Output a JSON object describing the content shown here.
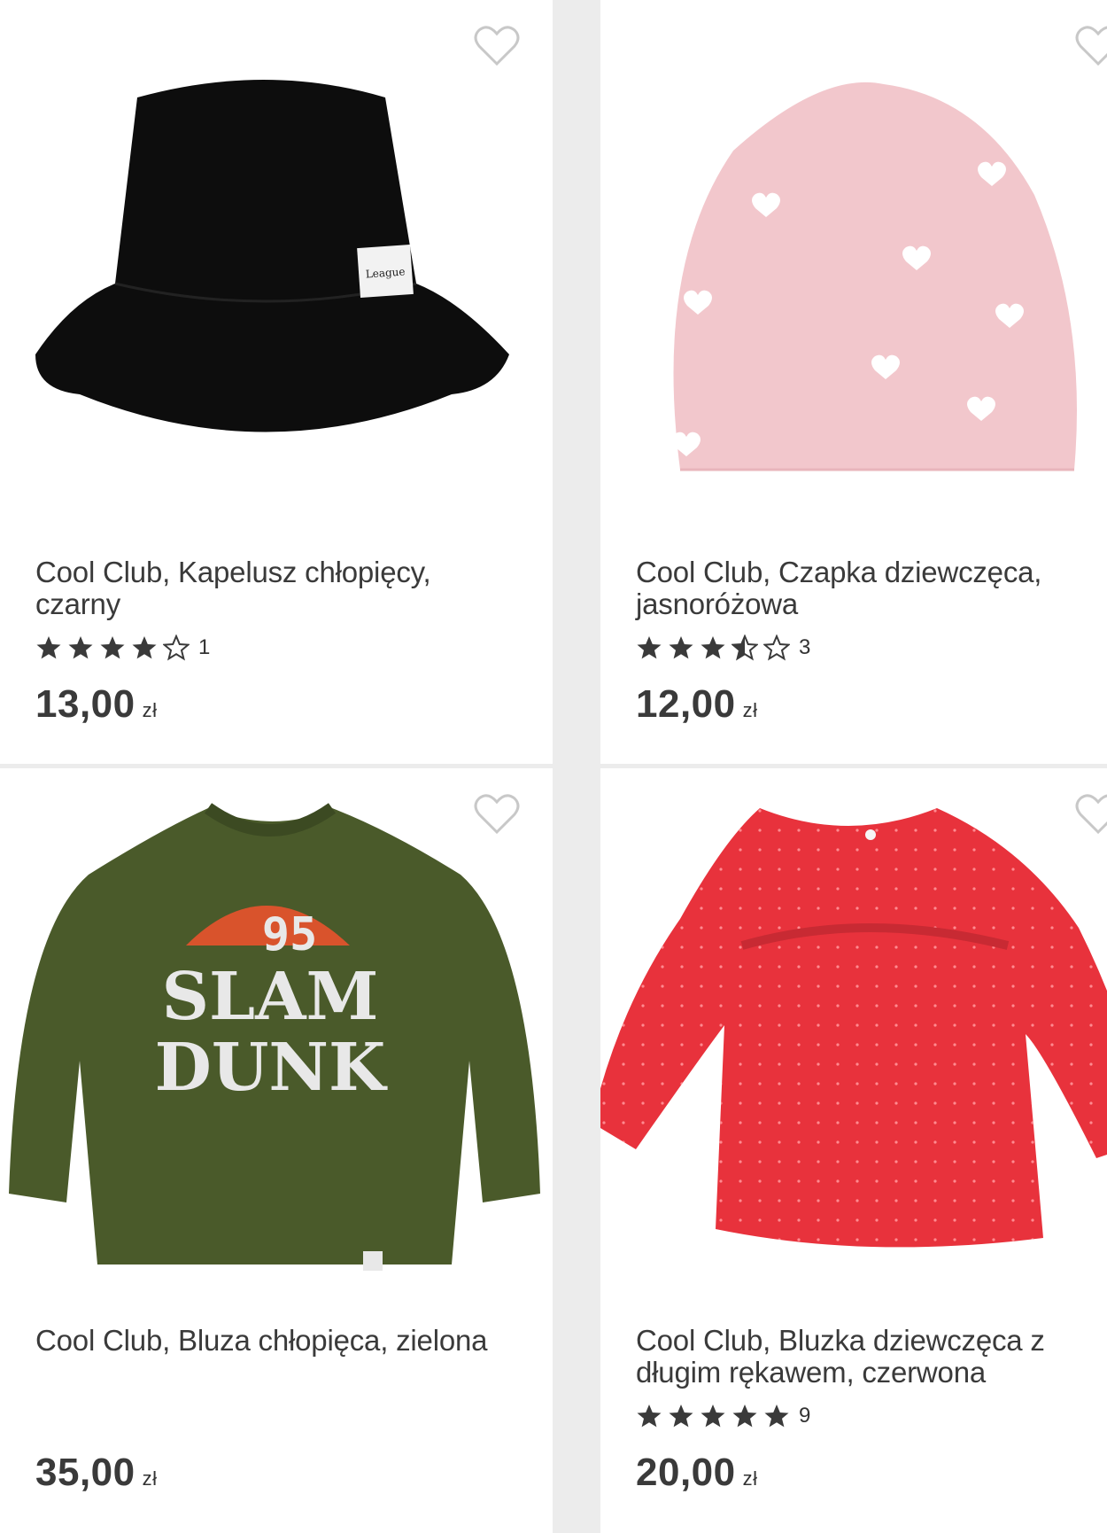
{
  "products": [
    {
      "title": "Cool Club, Kapelusz chłopięcy, czarny",
      "rating": 4,
      "reviews": "1",
      "price": "13,00",
      "currency": "zł",
      "image": "black-bucket-hat"
    },
    {
      "title": "Cool Club, Czapka dziewczęca, jasnoróżowa",
      "rating": 3.5,
      "reviews": "3",
      "price": "12,00",
      "currency": "zł",
      "image": "pink-beanie-with-hearts"
    },
    {
      "title": "Cool Club, Bluza chłopięca, zielona",
      "rating": null,
      "reviews": "",
      "price": "35,00",
      "currency": "zł",
      "image": "green-sweatshirt",
      "print_lines": [
        "95",
        "SLAM",
        "DUNK"
      ]
    },
    {
      "title": "Cool Club, Bluzka dziewczęca z długim rękawem, czerwona",
      "rating": 5,
      "reviews": "9",
      "price": "20,00",
      "currency": "zł",
      "image": "red-long-sleeve-blouse"
    }
  ],
  "colors": {
    "star": "#3a3a3a",
    "heart_outline": "#c8c8c8",
    "text": "#3a3a3a"
  },
  "icons": {
    "favorite": "heart-outline-icon",
    "rating": "star-icon"
  }
}
